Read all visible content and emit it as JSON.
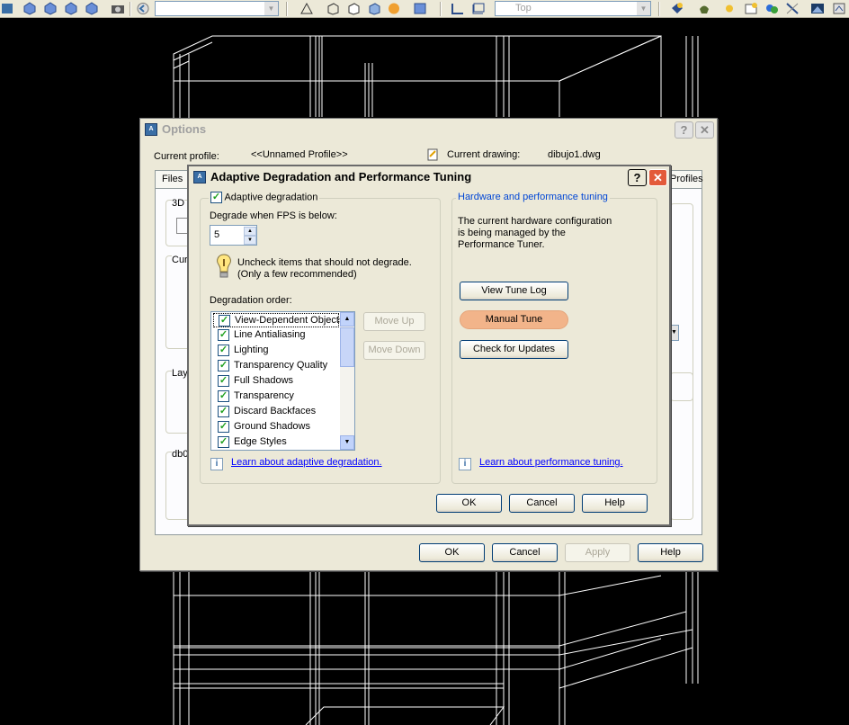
{
  "toolbar": {
    "view_combo": "Top"
  },
  "options_window": {
    "title": "Options",
    "current_profile_label": "Current profile:",
    "current_profile_value": "<<Unnamed Profile>>",
    "current_drawing_label": "Current drawing:",
    "current_drawing_value": "dibujo1.dwg",
    "tab_files": "Files",
    "tab_profiles": "Profiles",
    "frag_3d": "3D",
    "frag_cur": "Cur",
    "frag_lay": "Lay",
    "frag_db": "db0",
    "ok": "OK",
    "cancel": "Cancel",
    "apply": "Apply",
    "help": "Help"
  },
  "adaptive_dialog": {
    "title": "Adaptive Degradation and Performance Tuning",
    "adaptive_checkbox_label": "Adaptive degradation",
    "fps_label": "Degrade when FPS is below:",
    "fps_value": "5",
    "hint_line1": "Uncheck items that should not degrade.",
    "hint_line2": "(Only a few recommended)",
    "order_label": "Degradation order:",
    "degradation_items": [
      "View-Dependent Objects",
      "Line Antialiasing",
      "Lighting",
      "Transparency Quality",
      "Full Shadows",
      "Transparency",
      "Discard Backfaces",
      "Ground Shadows",
      "Edge Styles"
    ],
    "move_up": "Move Up",
    "move_down": "Move Down",
    "learn_adaptive": "Learn about adaptive degradation.",
    "hw_group_title": "Hardware and performance tuning",
    "hw_line1": "The current hardware configuration",
    "hw_line2": "is being managed by the",
    "hw_line3": "Performance Tuner.",
    "view_tune_log": "View Tune Log",
    "manual_tune": "Manual Tune",
    "check_updates": "Check for Updates",
    "learn_performance": "Learn about performance tuning.",
    "ok": "OK",
    "cancel": "Cancel",
    "help": "Help"
  },
  "colors": {
    "dialog_bg": "#ece9d8",
    "hw_title": "#0046d5",
    "highlight": "#f2b48a",
    "wireframe": "#ffffff"
  }
}
